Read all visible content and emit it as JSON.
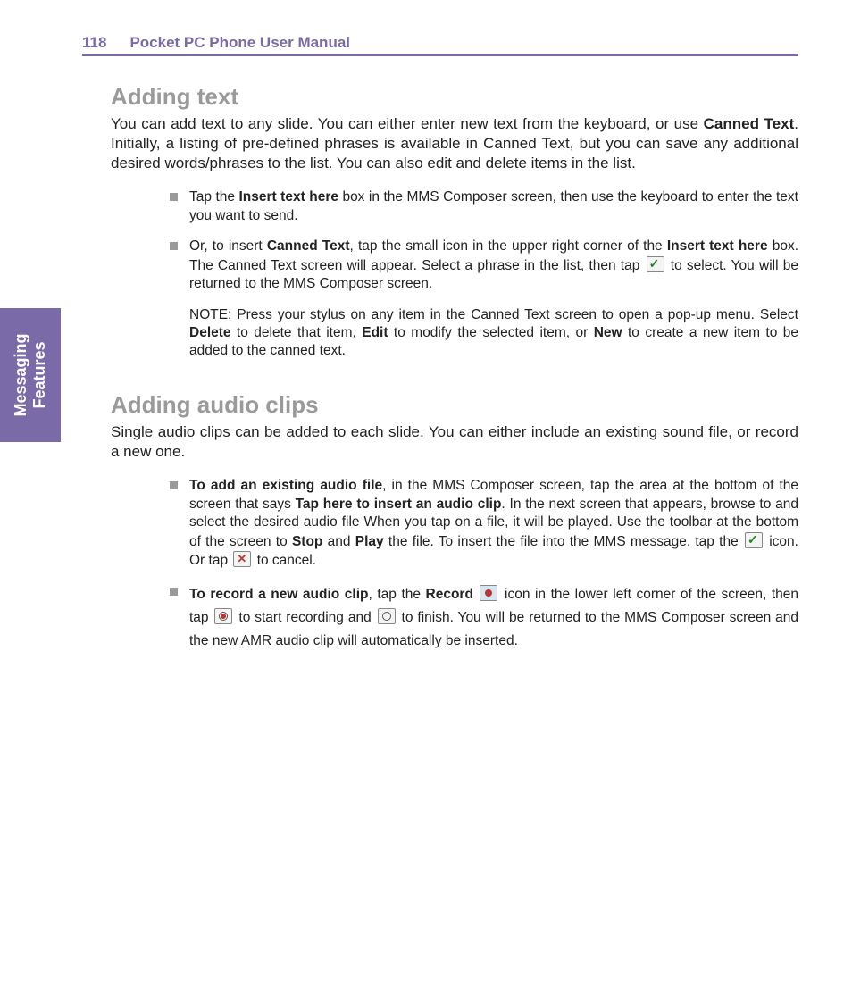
{
  "header": {
    "page_number": "118",
    "title": "Pocket PC Phone User Manual"
  },
  "side_tab": {
    "line1": "Messaging",
    "line2": "Features"
  },
  "section1": {
    "heading": "Adding text",
    "intro_pre": "You can add text to any slide.  You can either enter new text from the keyboard, or use ",
    "intro_bold": "Canned Text",
    "intro_post": ".  Initially, a listing of pre-defined phrases is available in Canned Text, but you can save any additional desired words/phrases to the list.  You can also edit and delete items in the list.",
    "item1_pre": "Tap the ",
    "item1_b1": "Insert text here",
    "item1_post": " box in the MMS Composer screen, then use the keyboard to enter the text you want to send.",
    "item2_pre": "Or, to insert ",
    "item2_b1": "Canned Text",
    "item2_mid1": ", tap the small icon in the upper right corner of the ",
    "item2_b2": "Insert text here",
    "item2_mid2": " box.  The Canned Text screen will appear.  Select a phrase in the list, then tap ",
    "item2_post": " to select.  You will be returned to the MMS Composer screen.",
    "note_pre": "NOTE:   Press your stylus on any item in the Canned Text screen to open a pop-up menu.  Select ",
    "note_b1": "Delete",
    "note_mid1": " to delete that item, ",
    "note_b2": "Edit",
    "note_mid2": " to modify the selected item, or ",
    "note_b3": "New",
    "note_post": " to create a new item to be added to the canned text."
  },
  "section2": {
    "heading": "Adding audio clips",
    "intro": "Single audio clips can be added to each slide.  You can either include an existing sound file, or record a new one.",
    "item1_b1": "To add an existing audio file",
    "item1_mid1": ", in the MMS Composer screen, tap the area at the bottom of the screen that says ",
    "item1_b2": "Tap here to insert an audio clip",
    "item1_mid2": ".  In the next screen that appears, browse to and select the desired audio file  When you tap on a file, it will be played.  Use the toolbar at the bottom of the screen to ",
    "item1_b3": "Stop",
    "item1_mid3": " and ",
    "item1_b4": "Play",
    "item1_mid4": " the file.  To insert the file into the MMS message, tap the ",
    "item1_mid5": " icon.  Or tap ",
    "item1_post": " to cancel.",
    "item2_b1": "To record a new audio clip",
    "item2_mid1": ", tap the ",
    "item2_b2": "Record",
    "item2_mid2": "  icon in the lower left corner of the screen, then tap ",
    "item2_mid3": " to start recording and ",
    "item2_post": " to finish.  You will be returned to the MMS Composer screen and the new AMR audio clip will automatically be inserted."
  }
}
